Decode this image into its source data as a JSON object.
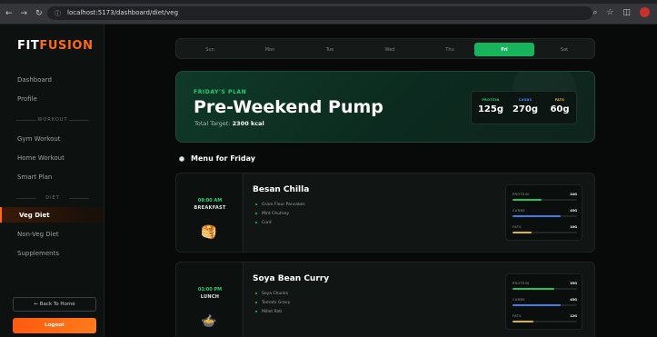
{
  "browser": {
    "url": "localhost:5173/dashboard/diet/veg"
  },
  "sidebar": {
    "logo_a": "FIT",
    "logo_b": "FUSION",
    "items": {
      "dashboard": "Dashboard",
      "profile": "Profile",
      "workout_section": "WORKOUT",
      "gym_workout": "Gym Workout",
      "home_workout": "Home Workout",
      "smart_plan": "Smart Plan",
      "diet_section": "DIET",
      "veg_diet": "Veg Diet",
      "nonveg_diet": "Non-Veg Diet",
      "supplements": "Supplements"
    },
    "back_home": "← Back To Home",
    "logout": "Logout"
  },
  "days": [
    "Sun",
    "Mon",
    "Tue",
    "Wed",
    "Thu",
    "Fri",
    "Sat"
  ],
  "active_day": "Fri",
  "plan": {
    "tag": "FRIDAY'S PLAN",
    "title": "Pre-Weekend Pump",
    "target_label": "Total Target:",
    "target_value": "2300 kcal",
    "macros": [
      {
        "label": "PROTEIN",
        "value": "125g",
        "color": "#23d16d"
      },
      {
        "label": "CARBS",
        "value": "270g",
        "color": "#3b8cff"
      },
      {
        "label": "FATS",
        "value": "60g",
        "color": "#ffc21a"
      }
    ]
  },
  "menu": {
    "title": "Menu for Friday",
    "meals": [
      {
        "time": "08:00 AM",
        "meal": "BREAKFAST",
        "icon": "pancake-icon",
        "icon_glyph": "🥞",
        "dish": "Besan Chilla",
        "ingredients": [
          "Gram Flour Pancakes",
          "Mint Chutney",
          "Curd"
        ],
        "macros": [
          {
            "label": "PROTEIN",
            "value": "24G",
            "percent": 45,
            "color": "#23c25f"
          },
          {
            "label": "CARBS",
            "value": "45G",
            "percent": 75,
            "color": "#3b7fe6"
          },
          {
            "label": "FATS",
            "value": "10G",
            "percent": 30,
            "color": "#e2b51e"
          }
        ]
      },
      {
        "time": "01:00 PM",
        "meal": "LUNCH",
        "icon": "curry-bowl-icon",
        "icon_glyph": "🍲",
        "dish": "Soya Bean Curry",
        "ingredients": [
          "Soya Chunks",
          "Tomato Gravy",
          "Millet Roti"
        ],
        "macros": [
          {
            "label": "PROTEIN",
            "value": "35G",
            "percent": 65,
            "color": "#23c25f"
          },
          {
            "label": "CARBS",
            "value": "45G",
            "percent": 75,
            "color": "#3b7fe6"
          },
          {
            "label": "FATS",
            "value": "12G",
            "percent": 32,
            "color": "#e2b51e"
          }
        ]
      }
    ]
  }
}
